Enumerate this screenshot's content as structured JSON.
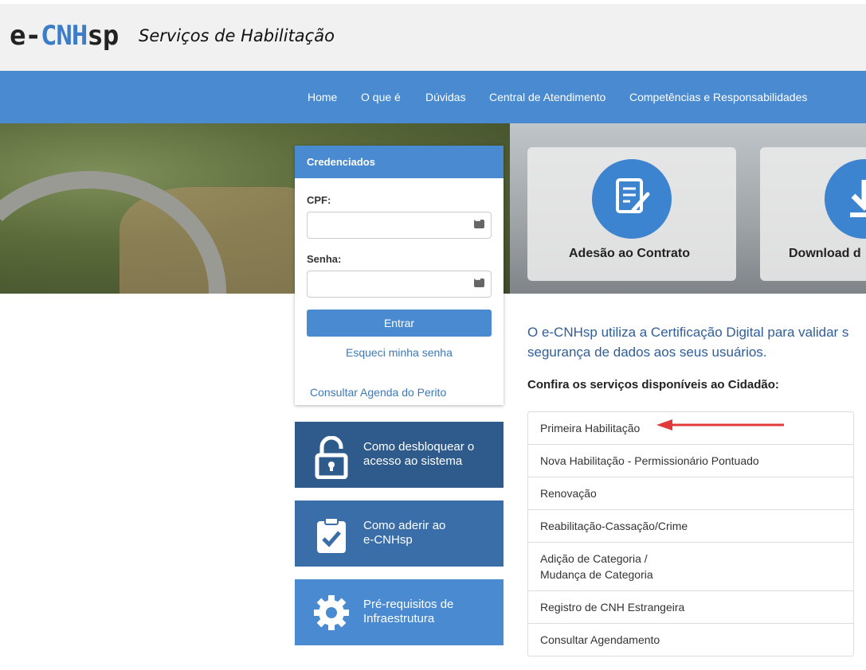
{
  "header": {
    "logo_prefix": "e-",
    "logo_accent": "CNH",
    "logo_suffix": "sp",
    "tagline": "Serviços de Habilitação"
  },
  "nav": {
    "items": [
      "Home",
      "O que é",
      "Dúvidas",
      "Central de Atendimento",
      "Competências e Responsabilidades"
    ]
  },
  "login": {
    "title": "Credenciados",
    "cpf_label": "CPF:",
    "password_label": "Senha:",
    "submit_label": "Entrar",
    "forgot_label": "Esqueci minha senha",
    "agenda_label": "Consultar Agenda do Perito"
  },
  "tiles": [
    {
      "line1": "Como desbloquear o",
      "line2": "acesso ao sistema",
      "icon": "padlock-icon"
    },
    {
      "line1": "Como aderir ao",
      "line2": "e-CNHsp",
      "icon": "clipboard-check-icon"
    },
    {
      "line1": "Pré-requisitos de",
      "line2": "Infraestrutura",
      "icon": "gear-icon"
    }
  ],
  "cards": [
    {
      "label": "Adesão ao Contrato",
      "icon": "contract-icon"
    },
    {
      "label": "Download d",
      "icon": "download-icon"
    }
  ],
  "intro": {
    "line1": "O e-CNHsp utiliza a Certificação Digital para validar s",
    "line2": "segurança de dados aos seus usuários."
  },
  "services": {
    "heading": "Confira os serviços disponíveis ao Cidadão:",
    "items": [
      {
        "line1": "Primeira Habilitação",
        "line2": ""
      },
      {
        "line1": "Nova Habilitação - Permissionário Pontuado",
        "line2": ""
      },
      {
        "line1": "Renovação",
        "line2": ""
      },
      {
        "line1": "Reabilitação-Cassação/Crime",
        "line2": ""
      },
      {
        "line1": "Adição de Categoria /",
        "line2": "Mudança de Categoria"
      },
      {
        "line1": "Registro de CNH Estrangeira",
        "line2": ""
      },
      {
        "line1": "Consultar Agendamento",
        "line2": ""
      }
    ]
  },
  "colors": {
    "primary": "#4a8ad0",
    "tile_dark": "#2e5b8c",
    "tile_mid": "#3a6ea8",
    "tile_light": "#4a8ad0",
    "annotation_arrow": "#e03a3a"
  }
}
